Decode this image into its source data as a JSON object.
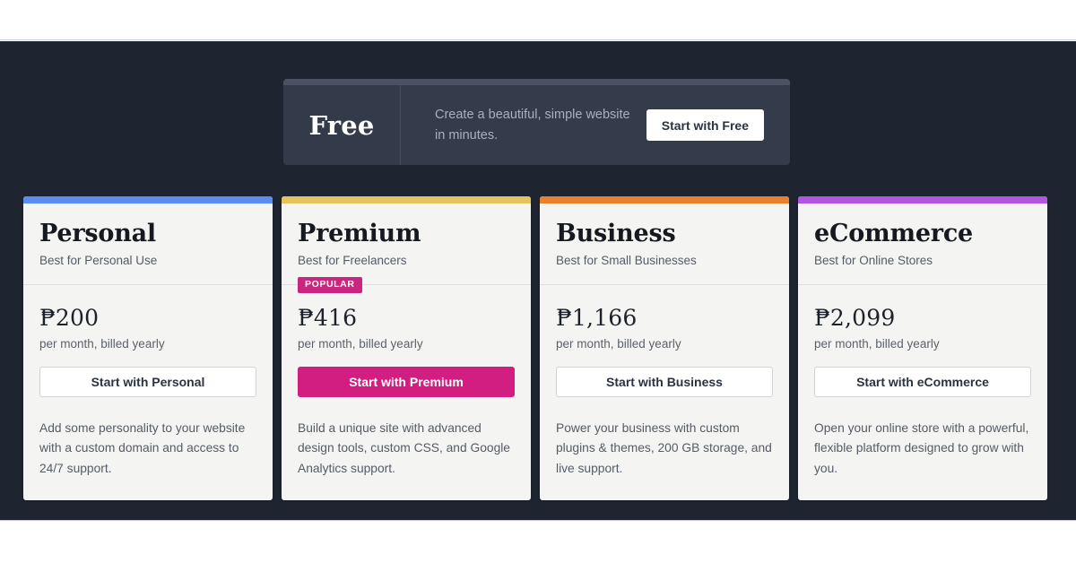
{
  "page": {
    "background_color": "#1e2430",
    "letterbox_color": "#ffffff"
  },
  "free_banner": {
    "name": "Free",
    "description": "Create a beautiful, simple website in minutes.",
    "cta_label": "Start with Free",
    "background_color": "#343b4a",
    "topbar_color": "#4a5264"
  },
  "plans": [
    {
      "name": "Personal",
      "tagline": "Best for Personal Use",
      "badge": null,
      "price": "₱200",
      "period": "per month, billed yearly",
      "cta_label": "Start with Personal",
      "cta_style": "outline",
      "description": "Add some personality to your website with a custom domain and access to 24/7 support.",
      "accent_color": "#5b8def"
    },
    {
      "name": "Premium",
      "tagline": "Best for Freelancers",
      "badge": "POPULAR",
      "price": "₱416",
      "period": "per month, billed yearly",
      "cta_label": "Start with Premium",
      "cta_style": "filled",
      "description": "Build a unique site with advanced design tools, custom CSS, and Google Analytics support.",
      "accent_color": "#e3c35b"
    },
    {
      "name": "Business",
      "tagline": "Best for Small Businesses",
      "badge": null,
      "price": "₱1,166",
      "period": "per month, billed yearly",
      "cta_label": "Start with Business",
      "cta_style": "outline",
      "description": "Power your business with custom plugins & themes, 200 GB storage, and live support.",
      "accent_color": "#e8812e"
    },
    {
      "name": "eCommerce",
      "tagline": "Best for Online Stores",
      "badge": null,
      "price": "₱2,099",
      "period": "per month, billed yearly",
      "cta_label": "Start with eCommerce",
      "cta_style": "outline",
      "description": "Open your online store with a powerful, flexible platform designed to grow with you.",
      "accent_color": "#b455e2"
    }
  ],
  "colors": {
    "badge_popular": "#c9267d",
    "cta_filled": "#d31e81",
    "card_background": "#f4f4f2"
  }
}
